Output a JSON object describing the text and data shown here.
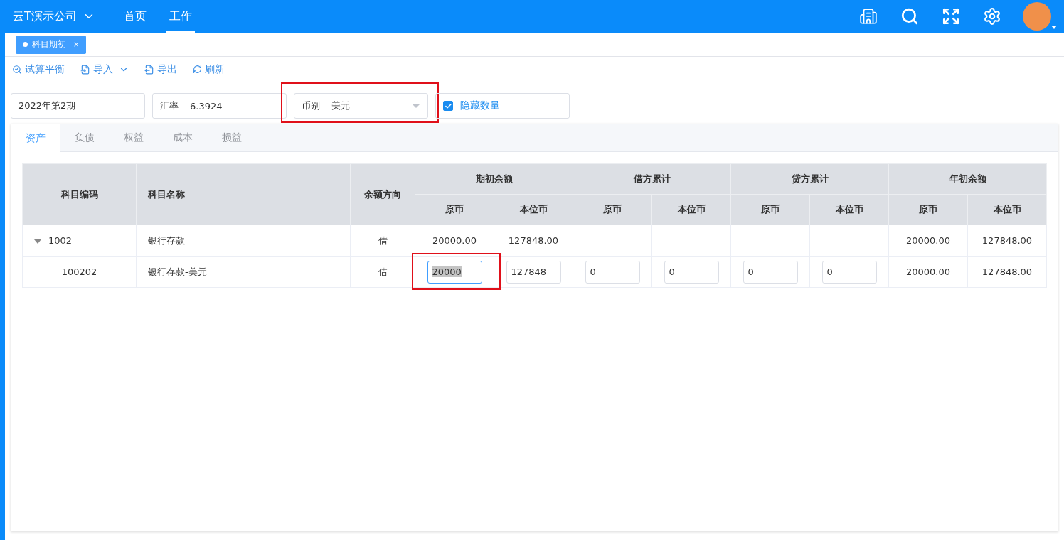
{
  "header": {
    "company": "云T演示公司",
    "nav": [
      {
        "label": "首页",
        "selected": false
      },
      {
        "label": "工作",
        "selected": true
      }
    ]
  },
  "open_tabs": [
    {
      "label": "科目期初",
      "close": "×",
      "selected": true
    }
  ],
  "toolbar": [
    {
      "kind": "balance",
      "label": "试算平衡",
      "dropdown": false
    },
    {
      "kind": "import",
      "label": "导入",
      "dropdown": true
    },
    {
      "kind": "export",
      "label": "导出",
      "dropdown": false
    },
    {
      "kind": "refresh",
      "label": "刷新",
      "dropdown": false
    }
  ],
  "filters": {
    "period": "2022年第2期",
    "rate_label": "汇率",
    "rate": "6.3924",
    "currency_label": "币别",
    "currency": "美元",
    "currency_highlighted": true,
    "hide_quantity": {
      "label": "隐藏数量",
      "checked": true
    }
  },
  "category_tabs": [
    {
      "label": "资产",
      "selected": true
    },
    {
      "label": "负债",
      "selected": false
    },
    {
      "label": "权益",
      "selected": false
    },
    {
      "label": "成本",
      "selected": false
    },
    {
      "label": "损益",
      "selected": false
    }
  ],
  "table": {
    "columns": [
      "科目编码",
      "科目名称",
      "余额方向"
    ],
    "groups": [
      {
        "label": "期初余额",
        "subcolumns": [
          "原币",
          "本位币"
        ]
      },
      {
        "label": "借方累计",
        "subcolumns": [
          "原币",
          "本位币"
        ]
      },
      {
        "label": "贷方累计",
        "subcolumns": [
          "原币",
          "本位币"
        ]
      },
      {
        "label": "年初余额",
        "subcolumns": [
          "原币",
          "本位币"
        ]
      }
    ],
    "rows": [
      {
        "code": "1002",
        "expanded": true,
        "name": "银行存款",
        "direction": "借",
        "cells": [
          {
            "kind": "text",
            "value": "20000.00"
          },
          {
            "kind": "text",
            "value": "127848.00"
          },
          {
            "kind": "blank"
          },
          {
            "kind": "blank"
          },
          {
            "kind": "blank"
          },
          {
            "kind": "blank"
          },
          {
            "kind": "text",
            "value": "20000.00"
          },
          {
            "kind": "text",
            "value": "127848.00"
          }
        ]
      },
      {
        "code": "100202",
        "name": "银行存款-美元",
        "direction": "借",
        "cells": [
          {
            "kind": "input",
            "value": "20000",
            "focused": true,
            "highlighted": true
          },
          {
            "kind": "input",
            "value": "127848",
            "focused": false,
            "highlighted": false
          },
          {
            "kind": "input",
            "value": "0",
            "focused": false,
            "highlighted": false
          },
          {
            "kind": "input",
            "value": "0",
            "focused": false,
            "highlighted": false
          },
          {
            "kind": "input",
            "value": "0",
            "focused": false,
            "highlighted": false
          },
          {
            "kind": "input",
            "value": "0",
            "focused": false,
            "highlighted": false
          },
          {
            "kind": "text",
            "value": "20000.00"
          },
          {
            "kind": "text",
            "value": "127848.00"
          }
        ]
      }
    ]
  }
}
